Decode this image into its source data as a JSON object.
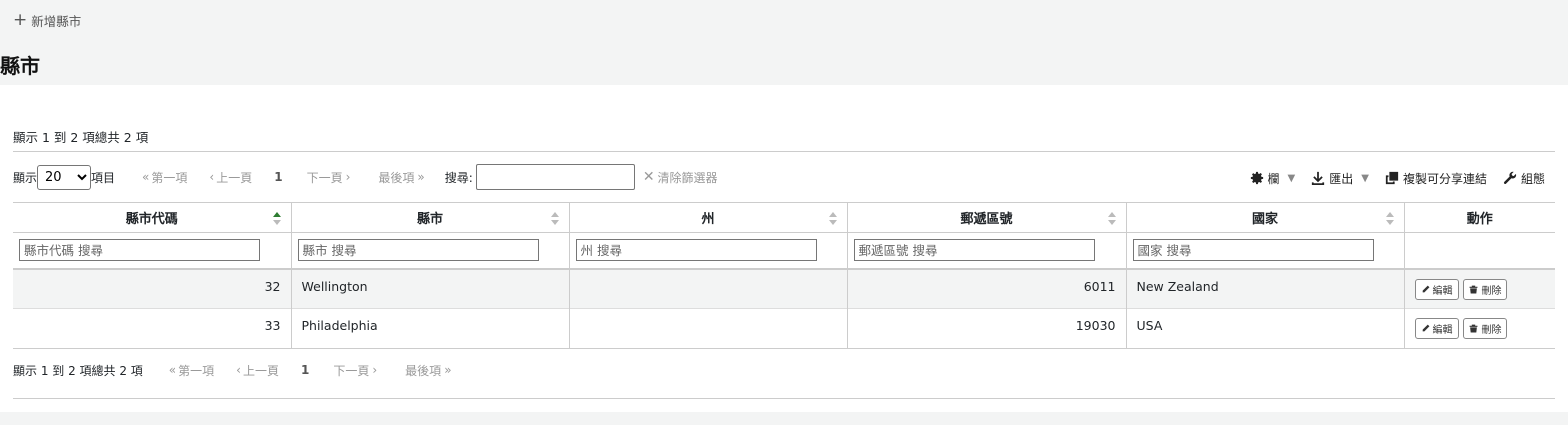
{
  "toolbar": {
    "new_label": "新增縣市"
  },
  "page_title": "縣市",
  "info_text": "顯示 1 到 2 項總共 2 項",
  "length": {
    "prefix": "顯示",
    "value": "20",
    "suffix": "項目"
  },
  "pagination": {
    "first": "第一項",
    "prev": "上一頁",
    "current": "1",
    "next": "下一頁",
    "last": "最後項"
  },
  "search": {
    "label": "搜尋:",
    "value": ""
  },
  "clear_filter": "清除篩選器",
  "tools": {
    "columns": "欄",
    "export": "匯出",
    "share": "複製可分享連結",
    "config": "組態"
  },
  "columns": [
    "縣市代碼",
    "縣市",
    "州",
    "郵遞區號",
    "國家",
    "動作"
  ],
  "filters": {
    "code": "縣市代碼 搜尋",
    "city": "縣市 搜尋",
    "state": "州 搜尋",
    "zip": "郵遞區號 搜尋",
    "country": "國家 搜尋"
  },
  "rows": [
    {
      "id": "32",
      "city": "Wellington",
      "state": "",
      "zip": "6011",
      "country": "New Zealand"
    },
    {
      "id": "33",
      "city": "Philadelphia",
      "state": "",
      "zip": "19030",
      "country": "USA"
    }
  ],
  "actions": {
    "edit": "編輯",
    "delete": "刪除"
  },
  "colors": {
    "sort_active": "#2e7d32",
    "sort_inactive": "#bbbbbb"
  }
}
